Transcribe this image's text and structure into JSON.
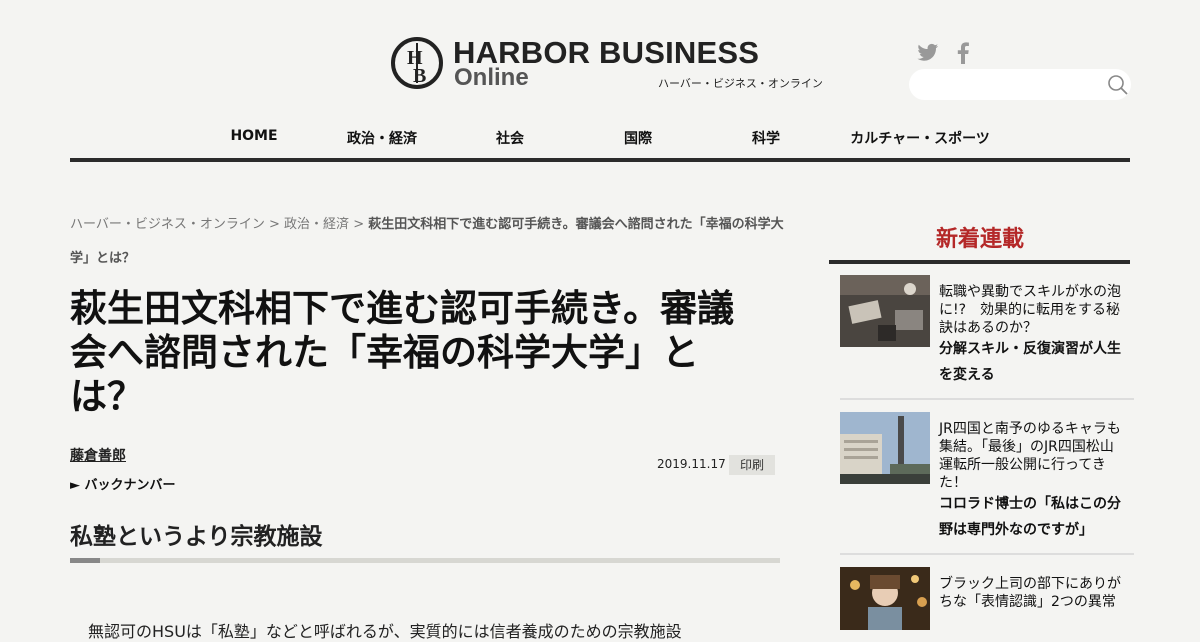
{
  "header": {
    "logo_title": "HARBOR BUSINESS",
    "logo_online": "Online",
    "logo_kana": "ハーバー・ビジネス・オンライン",
    "logo_mark": "HB",
    "search_placeholder": "",
    "icons": {
      "twitter": "twitter-icon",
      "facebook": "facebook-icon",
      "search": "search-icon"
    }
  },
  "nav": [
    {
      "label": "HOME"
    },
    {
      "label": "政治・経済"
    },
    {
      "label": "社会"
    },
    {
      "label": "国際"
    },
    {
      "label": "科学"
    },
    {
      "label": "カルチャー・スポーツ"
    }
  ],
  "breadcrumb": {
    "home": "ハーバー・ビジネス・オンライン",
    "sep": " > ",
    "category": "政治・経済",
    "current": "萩生田文科相下で進む認可手続き。審議会へ諮問された「幸福の科学大学」とは？"
  },
  "article": {
    "title": "萩生田文科相下で進む認可手続き。審議会へ諮問された「幸福の科学大学」とは？",
    "author": "藤倉善郎",
    "backnumber": "► バックナンバー",
    "date": "2019.11.17",
    "print_label": "印刷",
    "subhead": "私塾というより宗教施設",
    "body_visible": "無認可のHSUは「私塾」などと呼ばれるが、実質的には信者養成のための宗教施設"
  },
  "sidebar": {
    "title": "新着連載",
    "items": [
      {
        "headline": "転職や異動でスキルが水の泡に!?　効果的に転用をする秘訣はあるのか？",
        "series": "分解スキル・反復演習が人生を変える"
      },
      {
        "headline": "JR四国と南予のゆるキャラも集結。「最後」のJR四国松山運転所一般公開に行ってきた！",
        "series": "コロラド博士の「私はこの分野は専門外なのですが」"
      },
      {
        "headline": "ブラック上司の部下にありがちな「表情認識」2つの異常",
        "series": ""
      }
    ]
  },
  "colors": {
    "accent_red": "#b42828",
    "rule_dark": "#2b2b2b",
    "background": "#f4f4f2"
  }
}
